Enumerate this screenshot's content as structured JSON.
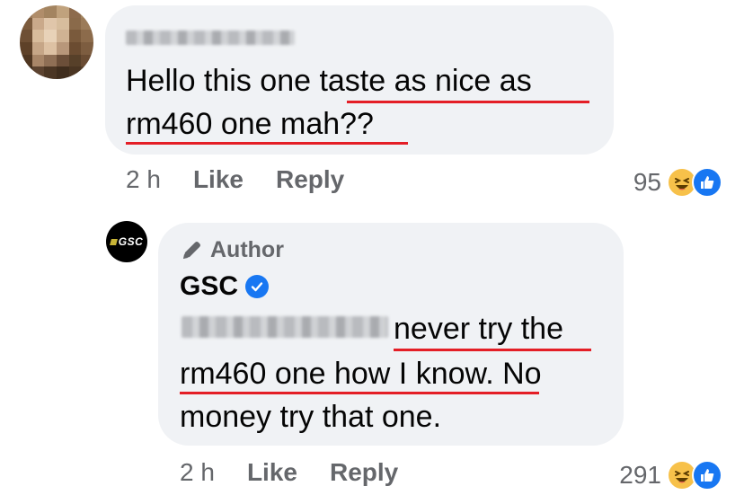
{
  "comments": [
    {
      "author_name_visible": false,
      "text_lines": [
        "Hello this one taste as nice as",
        "rm460 one mah??"
      ],
      "time": "2 h",
      "like_label": "Like",
      "reply_label": "Reply",
      "reaction_count": "95",
      "reactions": [
        "haha-icon",
        "like-icon"
      ]
    },
    {
      "author_badge": "Author",
      "author_name": "GSC",
      "verified": true,
      "text_line1_after_mention": "never try the",
      "text_line2": "rm460 one how I know. No",
      "text_line3": "money try that one.",
      "time": "2 h",
      "like_label": "Like",
      "reply_label": "Reply",
      "reaction_count": "291",
      "reactions": [
        "haha-icon",
        "like-icon"
      ]
    }
  ],
  "logo_text": "GSC",
  "colors": {
    "bubble": "#f0f2f5",
    "underline": "#e41e26",
    "meta_text": "#65676b",
    "verified": "#1877f2"
  }
}
